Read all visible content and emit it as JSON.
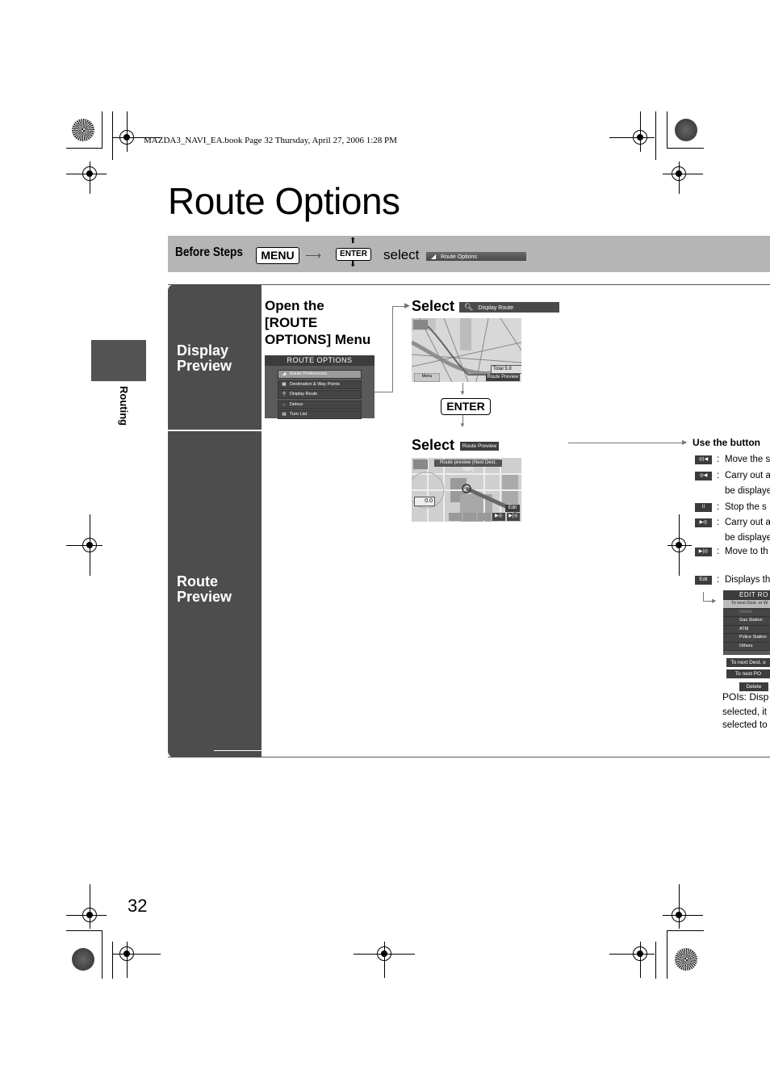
{
  "print_header": "MAZDA3_NAVI_EA.book  Page 32  Thursday, April 27, 2006  1:28 PM",
  "title": "Route Options",
  "side_tab": {
    "label": "Routing"
  },
  "before_steps": {
    "label": "Before Steps",
    "menu_key": "MENU",
    "enter_key": "ENTER",
    "select_word": "select",
    "select_item": "Route Options"
  },
  "sections": [
    {
      "label_line1": "Display",
      "label_line2": "Preview"
    },
    {
      "label_line1": "Route",
      "label_line2": "Preview"
    }
  ],
  "step1": {
    "heading_line1": "Open the",
    "heading_line2": "[ROUTE",
    "heading_line3": "OPTIONS] Menu",
    "menu_title": "ROUTE OPTIONS",
    "menu_items": [
      "Route Preferences",
      "Destination & Way Points",
      "Display Route",
      "Detour",
      "Turn List"
    ]
  },
  "step2": {
    "select_word": "Select",
    "select_item": "Display Route",
    "map_total": "Total  5.9",
    "map_button": "Route Preview",
    "map_menu": "Menu",
    "enter_key": "ENTER"
  },
  "step3": {
    "select_word": "Select",
    "select_item": "Route Preview",
    "map_banner": "Route preview (Next Dest. /WP)",
    "map_distance": "0.0",
    "map_edit": "Edit"
  },
  "buttons_panel": {
    "heading": "Use the button",
    "items": [
      {
        "icon": "rewind-to-start-icon",
        "text": "Move the s"
      },
      {
        "icon": "rewind-icon",
        "text": "Carry out a",
        "text2": "be displaye"
      },
      {
        "icon": "pause-icon",
        "text": "Stop the s"
      },
      {
        "icon": "play-icon",
        "text": "Carry out a",
        "text2": "be displaye"
      },
      {
        "icon": "skip-to-end-icon",
        "text": "Move to th"
      },
      {
        "icon": "edit-icon",
        "icon_label": "Edit",
        "text": "Displays th"
      }
    ],
    "edit_menu": {
      "title": "EDIT RO",
      "items": [
        "To next Dest. or W",
        "Delete",
        "Gas Station",
        "ATM",
        "Police Station",
        "Others"
      ]
    },
    "labels": [
      "To next Dest. o",
      "To next PO",
      "Delete"
    ],
    "pois_text": [
      "POIs: Disp",
      "selected, it",
      "selected to"
    ]
  },
  "page_number": "32"
}
